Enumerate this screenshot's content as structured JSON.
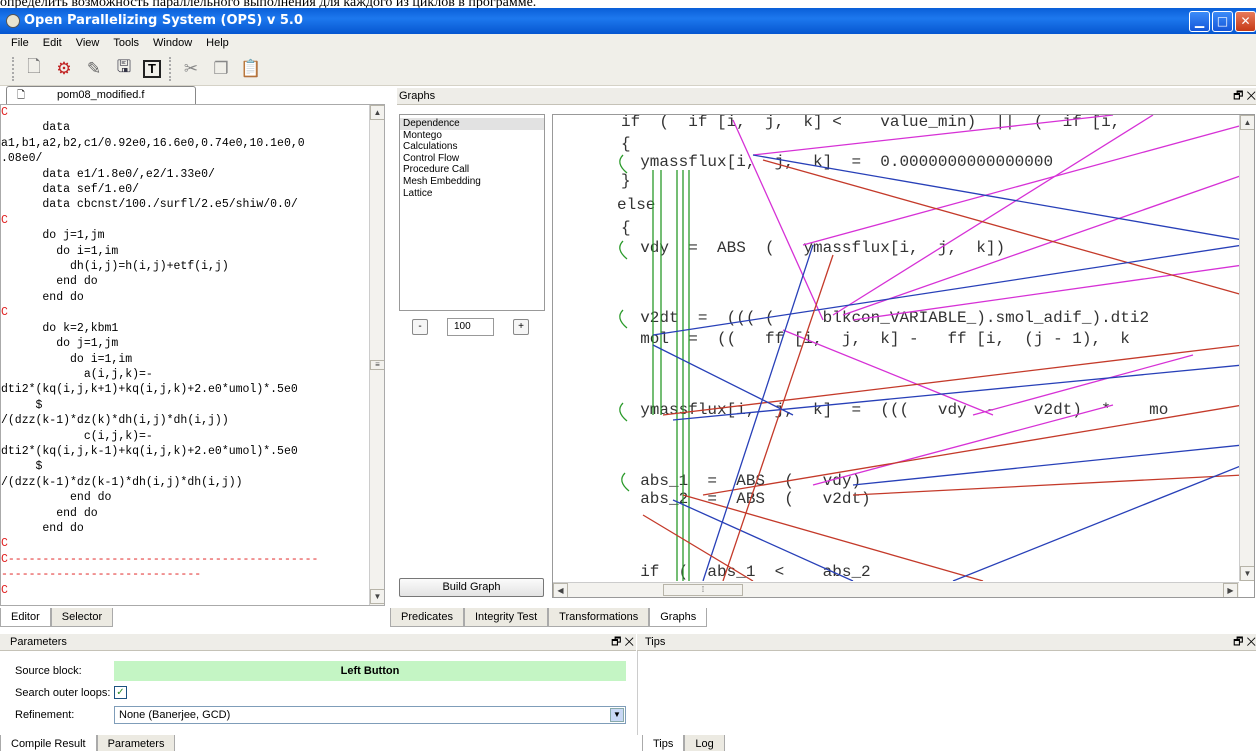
{
  "caption": "определить возможность параллельного выполнения для каждого из циклов в программе.",
  "window": {
    "title": "Open Parallelizing System (OPS) v 5.0",
    "minimize": "▁",
    "maximize": "□",
    "close": "✕"
  },
  "menu": [
    "File",
    "Edit",
    "View",
    "Tools",
    "Window",
    "Help"
  ],
  "toolbar": {
    "icons": [
      "new-file-icon",
      "source-icon",
      "edit-icon",
      "save-icon",
      "text-tool-icon",
      "cut-icon",
      "copy-icon",
      "paste-icon"
    ],
    "glyphs": [
      "🗋",
      "⚙",
      "✎",
      "🖫",
      "T",
      "✂",
      "❐",
      "📋"
    ]
  },
  "editor": {
    "tab_label": "pom08_modified.f",
    "code_lines": [
      {
        "t": "C",
        "c": true
      },
      {
        "t": "      data",
        "c": false
      },
      {
        "t": "a1,b1,a2,b2,c1/0.92e0,16.6e0,0.74e0,10.1e0,0",
        "c": false
      },
      {
        "t": ".08e0/",
        "c": false
      },
      {
        "t": "      data e1/1.8e0/,e2/1.33e0/",
        "c": false
      },
      {
        "t": "      data sef/1.e0/",
        "c": false
      },
      {
        "t": "      data cbcnst/100./surfl/2.e5/shiw/0.0/",
        "c": false
      },
      {
        "t": "C",
        "c": true
      },
      {
        "t": "      do j=1,jm",
        "c": false
      },
      {
        "t": "        do i=1,im",
        "c": false
      },
      {
        "t": "          dh(i,j)=h(i,j)+etf(i,j)",
        "c": false
      },
      {
        "t": "        end do",
        "c": false
      },
      {
        "t": "      end do",
        "c": false
      },
      {
        "t": "C",
        "c": true
      },
      {
        "t": "      do k=2,kbm1",
        "c": false
      },
      {
        "t": "        do j=1,jm",
        "c": false
      },
      {
        "t": "          do i=1,im",
        "c": false
      },
      {
        "t": "            a(i,j,k)=-",
        "c": false
      },
      {
        "t": "dti2*(kq(i,j,k+1)+kq(i,j,k)+2.e0*umol)*.5e0",
        "c": false
      },
      {
        "t": "     $",
        "c": false
      },
      {
        "t": "/(dzz(k-1)*dz(k)*dh(i,j)*dh(i,j))",
        "c": false
      },
      {
        "t": "            c(i,j,k)=-",
        "c": false
      },
      {
        "t": "dti2*(kq(i,j,k-1)+kq(i,j,k)+2.e0*umol)*.5e0",
        "c": false
      },
      {
        "t": "     $",
        "c": false
      },
      {
        "t": "/(dzz(k-1)*dz(k-1)*dh(i,j)*dh(i,j))",
        "c": false
      },
      {
        "t": "          end do",
        "c": false
      },
      {
        "t": "        end do",
        "c": false
      },
      {
        "t": "      end do",
        "c": false
      },
      {
        "t": "C",
        "c": true
      },
      {
        "t": "C---------------------------------------------",
        "c": true
      },
      {
        "t": "-----------------------------",
        "c": true
      },
      {
        "t": "C",
        "c": true
      }
    ]
  },
  "left_tabs": [
    "Editor",
    "Selector"
  ],
  "graphs": {
    "panel_title": "Graphs",
    "panel_icons": "🗗 ✕",
    "types": [
      "Dependence",
      "Montego",
      "Calculations",
      "Control Flow",
      "Procedure Call",
      "Mesh Embedding",
      "Lattice"
    ],
    "selected_type": "Dependence",
    "zoom_minus": "-",
    "zoom_value": "100",
    "zoom_plus": "+",
    "build_button": "Build Graph",
    "statements": [
      "if  (  if [i,  j,  k] <    value_min)  ||  (  if [i,",
      "{",
      "  ymassflux[i,  j,  k]  =  0.0000000000000000",
      "}",
      "else",
      "{",
      "  vdy  =  ABS  (   ymassflux[i,  j,  k])",
      "  v2dt  =  ((( (     blkcon_VARIABLE_).smol_adif_).dti2",
      "  mol  =  ((   ff [i,  j,  k] -   ff [i,  (j - 1),  k",
      "  ymassflux[i,  j,  k]  =  (((   vdy  -    v2dt)  *    mo",
      "  abs_1  =  ABS  (   vdy)",
      "  abs_2  =  ABS  (   v2dt)",
      "  if  (  abs_1  <    abs_2"
    ]
  },
  "right_tabs": [
    "Predicates",
    "Integrity Test",
    "Transformations",
    "Graphs"
  ],
  "parameters": {
    "panel_title": "Parameters",
    "panel_icons": "🗗 ✕",
    "source_block_label": "Source block:",
    "source_block_value": "Left Button",
    "search_outer_label": "Search outer loops:",
    "search_outer_checked": "✓",
    "refinement_label": "Refinement:",
    "refinement_value": "None (Banerjee, GCD)"
  },
  "tips": {
    "panel_title": "Tips",
    "panel_icons": "🗗 ✕"
  },
  "bottom_left_tabs": [
    "Compile Result",
    "Parameters"
  ],
  "bottom_right_tabs": [
    "Tips",
    "Log"
  ],
  "colors": {
    "arc_magenta": "#d631d6",
    "arc_red": "#c43a2a",
    "arc_blue": "#2840b8",
    "arc_green": "#2a9a2a",
    "accent_green": "#c4f5c4"
  }
}
